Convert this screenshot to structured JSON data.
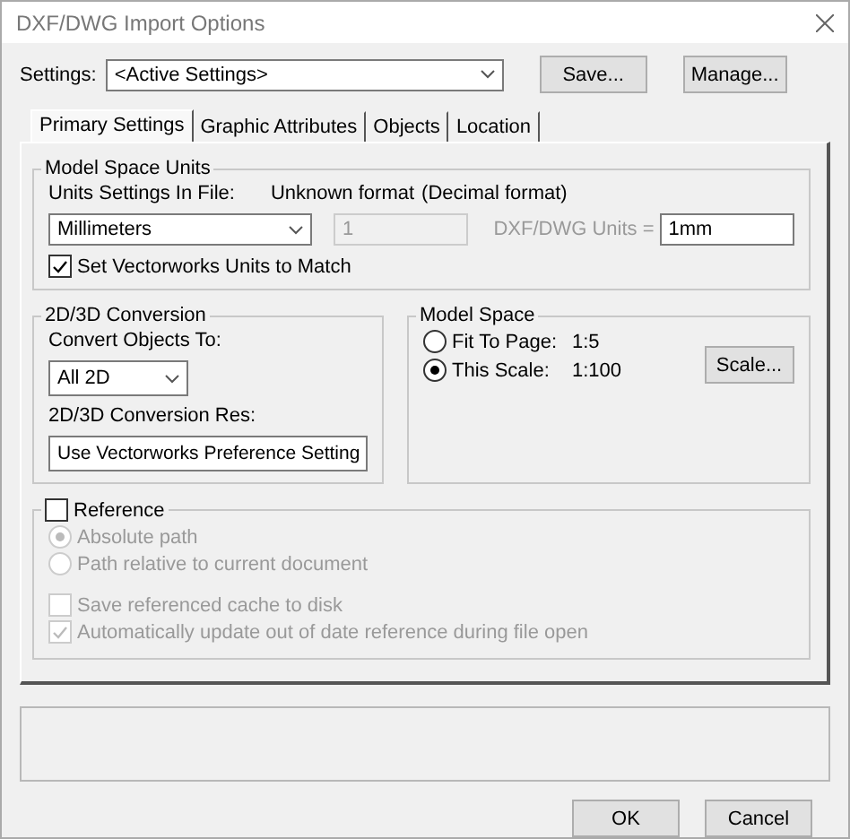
{
  "window": {
    "title": "DXF/DWG Import Options"
  },
  "settings": {
    "label": "Settings:",
    "value": "<Active Settings>",
    "buttons": [
      "Save...",
      "Manage..."
    ]
  },
  "tabs": [
    {
      "label": "Primary Settings",
      "selected": true
    },
    {
      "label": "Graphic Attributes",
      "selected": false
    },
    {
      "label": "Objects",
      "selected": false
    },
    {
      "label": "Location",
      "selected": false
    }
  ],
  "model_space_units": {
    "title": "Model Space Units",
    "file_units_label": "Units Settings In File:",
    "format": "Unknown format",
    "format_note": "(Decimal format)",
    "unit_select": "Millimeters",
    "ratio_value": "1",
    "ratio_label": "DXF/DWG Units =",
    "ratio_unit": "1mm",
    "ratio_disabled": true,
    "match": {
      "label": "Set Vectorworks Units to Match",
      "checked": true
    }
  },
  "conversion": {
    "title": "2D/3D Conversion",
    "convert_label": "Convert Objects To:",
    "convert_value": "All 2D",
    "res_label": "2D/3D Conversion Res:",
    "res_value": "Use Vectorworks Preference Setting"
  },
  "model_space": {
    "title": "Model Space",
    "options": [
      {
        "label": "Fit To Page:",
        "value": "1:5",
        "selected": false
      },
      {
        "label": "This Scale:",
        "value": "1:100",
        "selected": true
      }
    ],
    "scale_button": "Scale..."
  },
  "reference": {
    "label": "Reference",
    "checked": false,
    "path_options": [
      {
        "label": "Absolute path",
        "selected": true,
        "disabled": true
      },
      {
        "label": "Path relative to current document",
        "selected": false,
        "disabled": true
      }
    ],
    "options": [
      {
        "label": "Save referenced cache to disk",
        "checked": false,
        "disabled": true
      },
      {
        "label": "Automatically update out of date reference during file open",
        "checked": true,
        "disabled": true
      }
    ]
  },
  "buttons": [
    "OK",
    "Cancel"
  ]
}
